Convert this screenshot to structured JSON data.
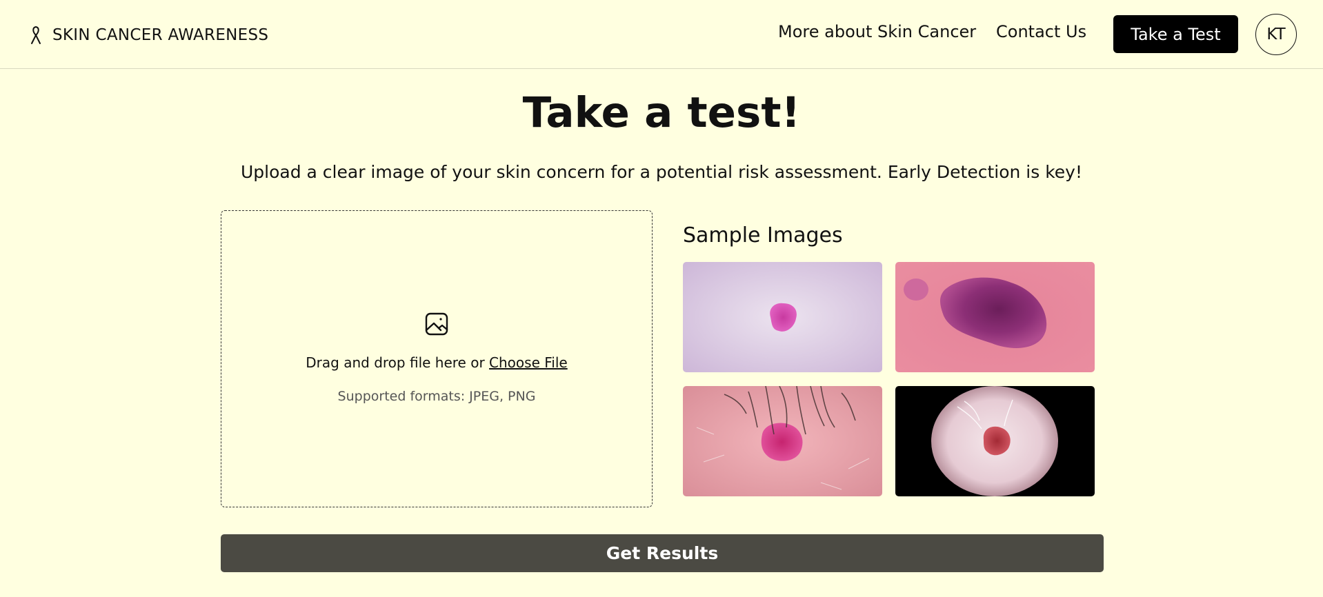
{
  "header": {
    "brand_icon": "ribbon-icon",
    "brand_text": "SKIN CANCER AWARENESS",
    "nav": {
      "more_label": "More about Skin Cancer",
      "contact_label": "Contact Us",
      "test_button_label": "Take a Test"
    },
    "avatar_initials": "KT"
  },
  "main": {
    "title": "Take a test!",
    "subtitle": "Upload a clear image of your skin concern for a potential risk assessment. Early Detection is key!",
    "upload": {
      "icon": "image-icon",
      "drag_text": "Drag and drop file here or ",
      "choose_file_label": "Choose File",
      "formats_text": "Supported formats: JPEG, PNG"
    },
    "samples": {
      "title": "Sample Images",
      "images": [
        {
          "name": "sample-image-1"
        },
        {
          "name": "sample-image-2"
        },
        {
          "name": "sample-image-3"
        },
        {
          "name": "sample-image-4"
        }
      ]
    },
    "submit_label": "Get Results"
  },
  "colors": {
    "page_background": "#ffffe0",
    "primary_button": "#000000",
    "submit_button": "#4b4a43"
  }
}
